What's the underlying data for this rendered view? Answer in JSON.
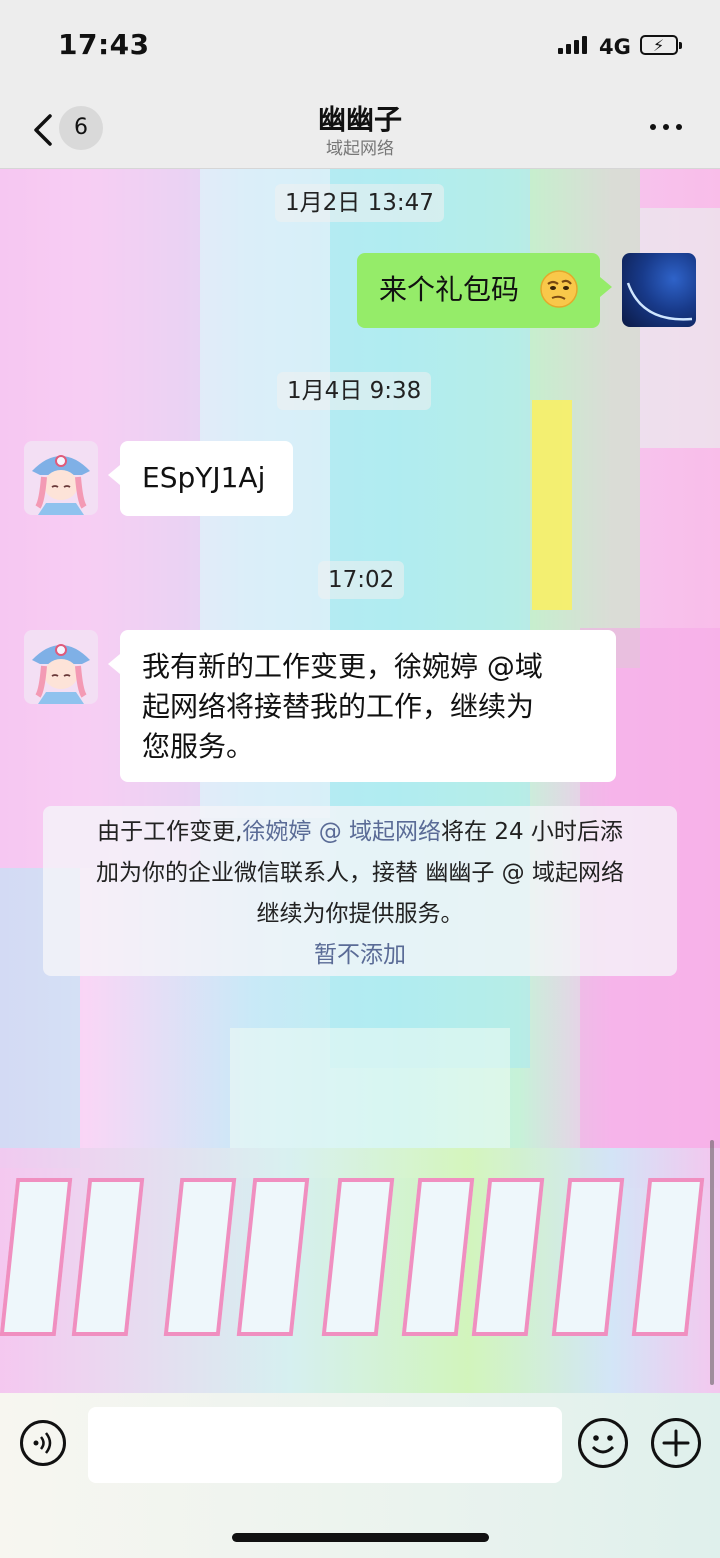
{
  "status_bar": {
    "time": "17:43",
    "network": "4G",
    "battery_icon": "battery-charging-icon"
  },
  "header": {
    "back_icon": "chevron-left-icon",
    "unread_count": "6",
    "title": "幽幽子",
    "subtitle": "域起网络",
    "more_icon": "more-dots-icon"
  },
  "messages": [
    {
      "type": "timestamp",
      "text": "1月2日 13:47"
    },
    {
      "type": "outgoing",
      "text": "来个礼包码",
      "emoji": "🤔"
    },
    {
      "type": "timestamp",
      "text": "1月4日 9:38"
    },
    {
      "type": "incoming",
      "text": "ESpYJ1Aj"
    },
    {
      "type": "timestamp",
      "text": "17:02"
    },
    {
      "type": "incoming",
      "lines": [
        "我有新的工作变更，徐婉婷 @域",
        "起网络将接替我的工作，继续为",
        "您服务。"
      ]
    }
  ],
  "notice": {
    "prefix": "由于工作变更,",
    "new_contact": "徐婉婷 @ 域起网络",
    "middle_1": "将在 24 小时后添",
    "line2": "加为你的企业微信联系人，接替 幽幽子 @ 域起网络",
    "line3": "继续为你提供服务。",
    "action": "暂不添加"
  },
  "input_bar": {
    "voice_icon": "voice-icon",
    "input_value": "",
    "emoji_icon": "emoji-icon",
    "plus_icon": "plus-icon"
  },
  "colors": {
    "outgoing_bubble": "#95ec69",
    "incoming_bubble": "#ffffff",
    "link": "#5a6b96",
    "header_bg": "#ededed"
  }
}
